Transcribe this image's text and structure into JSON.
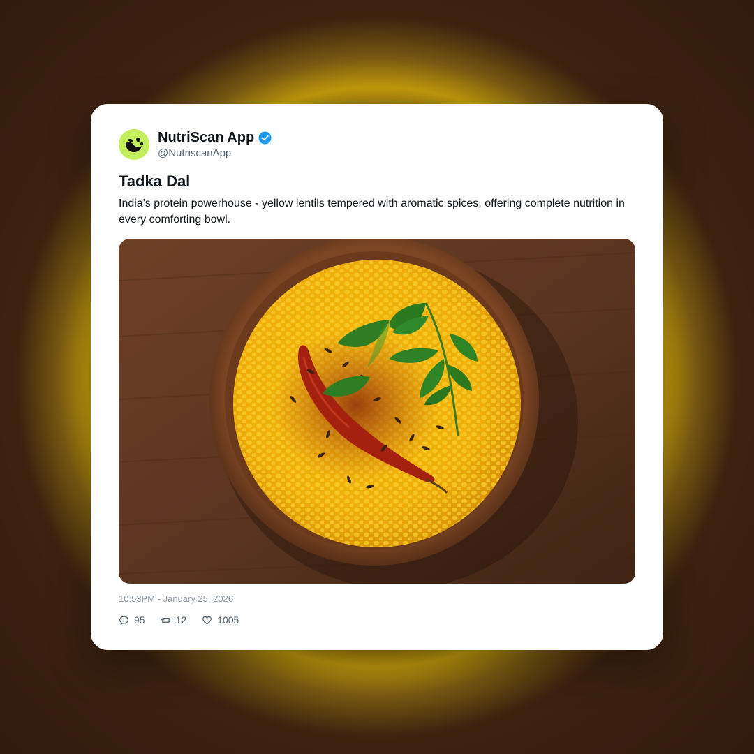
{
  "post": {
    "author": {
      "name": "NutriScan App",
      "handle": "@NutriscanApp",
      "verified": true,
      "avatar_icon": "nutriscan-logo-icon",
      "avatar_color": "#c4ef5c",
      "verified_color": "#1d9bf0"
    },
    "title": "Tadka Dal",
    "text": "India's protein powerhouse - yellow lentils tempered with aromatic spices, offering complete nutrition in every comforting bowl.",
    "image": {
      "subject": "bowl-of-tadka-dal",
      "icon": "dal-bowl-photo"
    },
    "timestamp": "10:53PM - January 25, 2026",
    "stats": {
      "replies": "95",
      "reposts": "12",
      "likes": "1005"
    }
  },
  "icons": {
    "reply": "comment-icon",
    "repost": "repost-icon",
    "like": "heart-icon"
  }
}
